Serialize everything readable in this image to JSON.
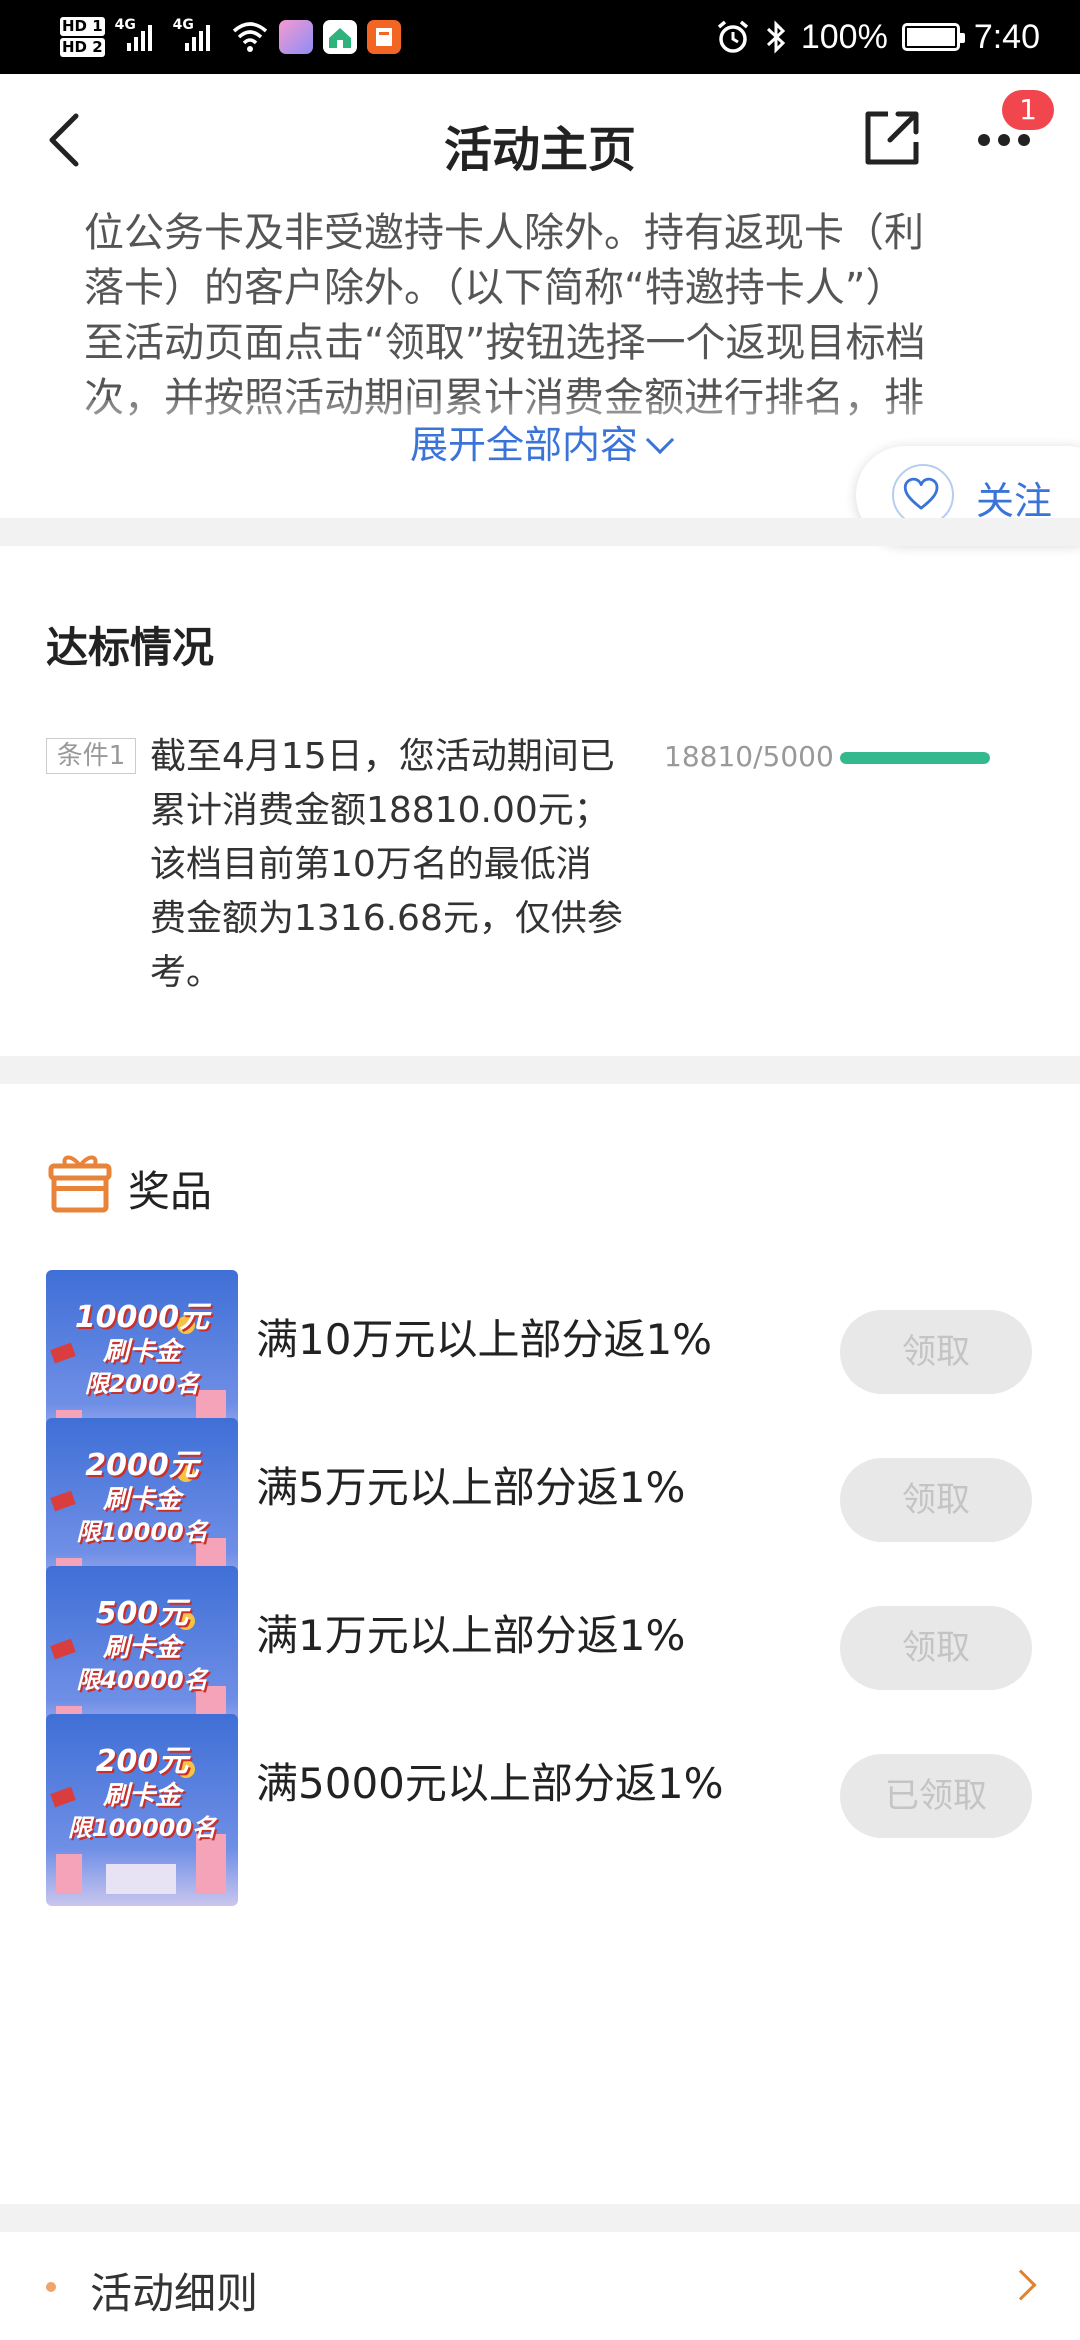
{
  "status_bar": {
    "battery": "100%",
    "time": "7:40",
    "network": "4G",
    "hd1": "HD 1",
    "hd2": "HD 2"
  },
  "header": {
    "title": "活动主页",
    "badge_count": "1"
  },
  "intro": {
    "lines": [
      "位公务卡及非受邀持卡人除外。持有返现卡（利",
      "落卡）的客户除外。（以下简称“特邀持卡人”）",
      "至活动页面点击“领取”按钮选择一个返现目标档",
      "次，并按照活动期间累计消费金额进行排名，排"
    ],
    "expand_label": "展开全部内容",
    "follow_label": "关注"
  },
  "status_section": {
    "title": "达标情况",
    "condition_tag": "条件1",
    "condition_lines": [
      "截至4月15日，您活动期间已",
      "累计消费金额18810.00元；",
      "该档目前第10万名的最低消",
      "费金额为1316.68元，仅供参",
      "考。"
    ],
    "progress_text": "18810/5000",
    "progress_fraction": 1.0
  },
  "prizes": {
    "title": "奖品",
    "items": [
      {
        "name": "满10万元以上部分返1%",
        "thumb_amount": "10000元",
        "thumb_line2": "刷卡金",
        "thumb_limit": "限2000名",
        "button": "领取"
      },
      {
        "name": "满5万元以上部分返1%",
        "thumb_amount": "2000元",
        "thumb_line2": "刷卡金",
        "thumb_limit": "限10000名",
        "button": "领取"
      },
      {
        "name": "满1万元以上部分返1%",
        "thumb_amount": "500元",
        "thumb_line2": "刷卡金",
        "thumb_limit": "限40000名",
        "button": "领取"
      },
      {
        "name": "满5000元以上部分返1%",
        "thumb_amount": "200元",
        "thumb_line2": "刷卡金",
        "thumb_limit": "限100000名",
        "button": "已领取"
      }
    ]
  },
  "footer": {
    "rules_label": "活动细则"
  },
  "colors": {
    "accent_blue": "#3a74d8",
    "progress_green": "#34b98e",
    "badge_red": "#f2464f",
    "gift_orange": "#e8833a"
  }
}
